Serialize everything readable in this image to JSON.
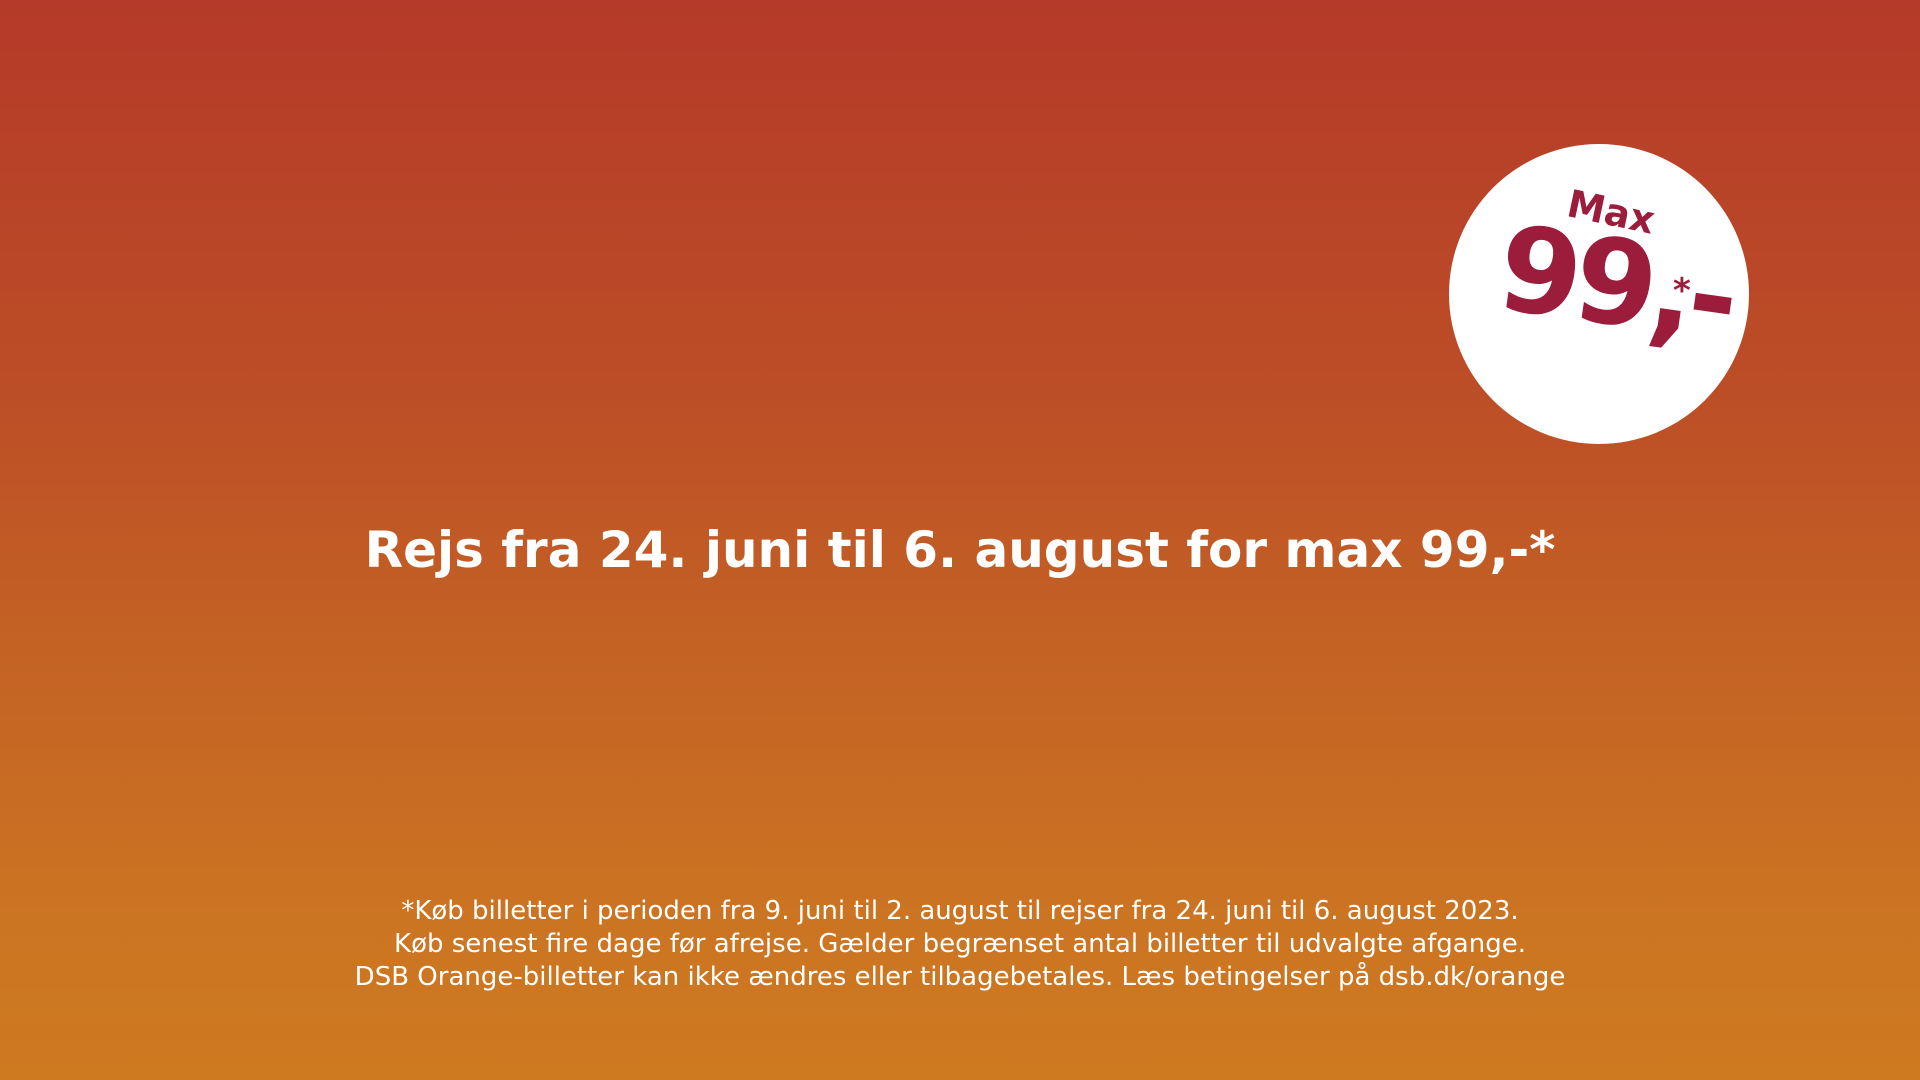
{
  "badge": {
    "max_label": "Max",
    "price": "99,-",
    "star": "*"
  },
  "headline": "Rejs fra 24. juni til 6. august for max 99,-*",
  "disclaimer": {
    "lines": [
      "*Køb billetter i perioden fra 9. juni til 2. august til rejser fra 24. juni til 6. august 2023.",
      "Køb senest fire dage før afrejse. Gælder begrænset antal billetter til udvalgte afgange.",
      "DSB Orange-billetter kan ikke ændres eller tilbagebetales. Læs betingelser på dsb.dk/orange"
    ]
  },
  "colors": {
    "background_top": "#b53a29",
    "background_bottom": "#ce7a21",
    "badge_fill": "#ffffff",
    "badge_text": "#9b1c3b",
    "text": "#ffffff"
  }
}
